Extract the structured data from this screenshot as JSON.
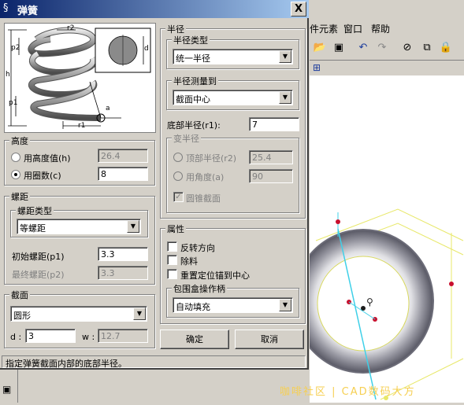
{
  "app": {
    "menu": [
      "件元素",
      "窗口",
      "帮助"
    ],
    "watermark": "咖啡社区 | CAD数码大方"
  },
  "dialog": {
    "title": "弹簧",
    "close_label": "X",
    "preview": {
      "label_r2": "r2",
      "label_d": "d",
      "label_p2": "p2",
      "label_h": "h",
      "label_p1": "p1",
      "label_r1": "r1",
      "label_a": "a"
    },
    "height_group": {
      "title": "高度",
      "option_height": "用高度值(h)",
      "option_turns": "用圈数(c)",
      "height_value": "26.4",
      "turns_value": "8"
    },
    "pitch_group": {
      "title": "螺距",
      "type_title": "螺距类型",
      "type_value": "等螺距",
      "start_label": "初始螺距(p1)",
      "start_value": "3.3",
      "end_label": "最终螺距(p2)",
      "end_value": "3.3"
    },
    "section_group": {
      "title": "截面",
      "shape_value": "圆形",
      "d_label": "d :",
      "d_value": "3",
      "w_label": "w :",
      "w_value": "12.7"
    },
    "radius_group": {
      "title": "半径",
      "type_title": "半径类型",
      "type_value": "统一半径",
      "measure_title": "半径测量到",
      "measure_value": "截面中心",
      "bottom_label": "底部半径(r1):",
      "bottom_value": "7",
      "variable_title": "变半径",
      "top_label": "顶部半径(r2)",
      "top_value": "25.4",
      "angle_label": "用角度(a)",
      "angle_value": "90",
      "round_label": "圆锥截面"
    },
    "props_group": {
      "title": "属性",
      "reverse_label": "反转方向",
      "cut_label": "除料",
      "reset_label": "重置定位锚到中心",
      "handle_title": "包围盒操作柄",
      "handle_value": "自动填充"
    },
    "ok_label": "确定",
    "cancel_label": "取消",
    "status": "指定弹簧截面内部的底部半径。"
  }
}
